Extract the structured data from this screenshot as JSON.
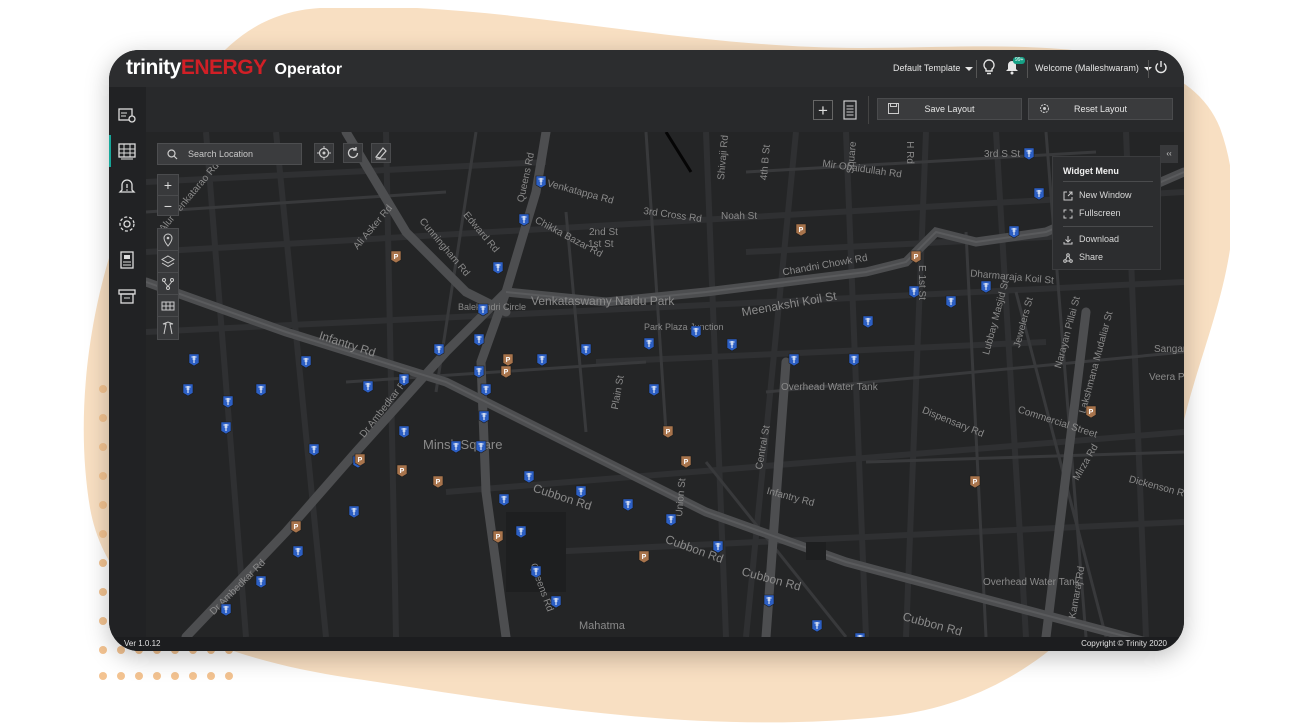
{
  "app": {
    "brand_trinity": "trinity",
    "brand_energy": "ENERGY",
    "module": "Operator"
  },
  "topbar": {
    "template_label": "Default Template",
    "notification_count": "99+",
    "welcome_label": "Welcome (Malleshwaram)"
  },
  "toolbar": {
    "save_layout": "Save Layout",
    "reset_layout": "Reset Layout"
  },
  "map": {
    "search_placeholder": "Search Location",
    "zoom_in": "+",
    "zoom_out": "−",
    "collapse": "‹‹",
    "street_labels": [
      "Alur Venkatarao Rd",
      "Queens Rd",
      "Ali Asker Rd",
      "Cunningham Rd",
      "Edward Rd",
      "Chikka Bazar Rd",
      "Venkatappa Rd",
      "2nd St",
      "1st St",
      "3rd Cross Rd",
      "Noah St",
      "Shivaji Rd",
      "4th B St",
      "Mir Obaidullah Rd",
      "H Rd",
      "3rd S St",
      "Chandni Chowk Rd",
      "Dharmaraja Koil St",
      "E 1st St",
      "Balekundri Circle",
      "Venkataswamy Naidu Park",
      "Meenakshi Koil St",
      "Park Plaza Junction",
      "Infantry Rd",
      "Dr Ambedkar Rd",
      "Plain St",
      "Overhead Water Tank",
      "Minsk Square",
      "Cubbon Rd",
      "Central St",
      "Infantry Rd",
      "Dispensary Rd",
      "Commercial Street",
      "Lubbay Masjid St",
      "Jewelers St",
      "Narayan Pillai St",
      "Lakshmana Mudaliar St",
      "Sangam",
      "Veera Pillai St",
      "Dickenson Rd",
      "Union St",
      "Dr Ambedkar Rd",
      "Queens Rd",
      "Mahatma",
      "Overhead Water Tank",
      "Cubbon Rd",
      "Cubbon Rd",
      "Cubbon Rd",
      "Kamaraj Rd",
      "Mirza Rd",
      "Square"
    ],
    "pin_counts": {
      "substation_pins": 66,
      "parking_pins": 16
    }
  },
  "widget_menu": {
    "title": "Widget Menu",
    "new_window": "New Window",
    "fullscreen": "Fullscreen",
    "download": "Download",
    "share": "Share"
  },
  "footer": {
    "version": "Ver 1.0.12",
    "copyright": "Copyright © Trinity 2020"
  },
  "colors": {
    "accent_red": "#d11f26",
    "accent_teal": "#17a79a",
    "pin_blue": "#2c5fc4",
    "pin_brown": "#a8744c",
    "background_blob": "#f8dfc2"
  }
}
